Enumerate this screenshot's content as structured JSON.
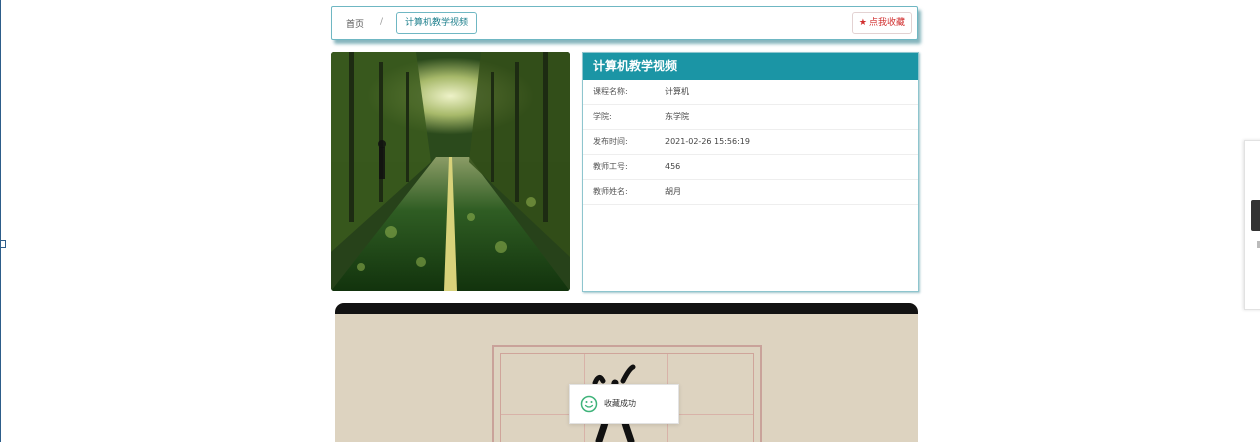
{
  "breadcrumb": {
    "home_label": "首页",
    "separator": "/",
    "current_label": "计算机教学视频"
  },
  "favorite_button": {
    "icon": "star-icon",
    "label": "点我收藏",
    "color": "#d12e2e"
  },
  "detail": {
    "title": "计算机教学视频",
    "header_color": "#1b95a5",
    "rows": [
      {
        "label": "课程名称:",
        "value": "计算机"
      },
      {
        "label": "学院:",
        "value": "东学院"
      },
      {
        "label": "发布时间:",
        "value": "2021-02-26 15:56:19"
      },
      {
        "label": "教师工号:",
        "value": "456"
      },
      {
        "label": "教师姓名:",
        "value": "胡月"
      }
    ]
  },
  "toast": {
    "icon": "smile-icon",
    "message": "收藏成功"
  }
}
